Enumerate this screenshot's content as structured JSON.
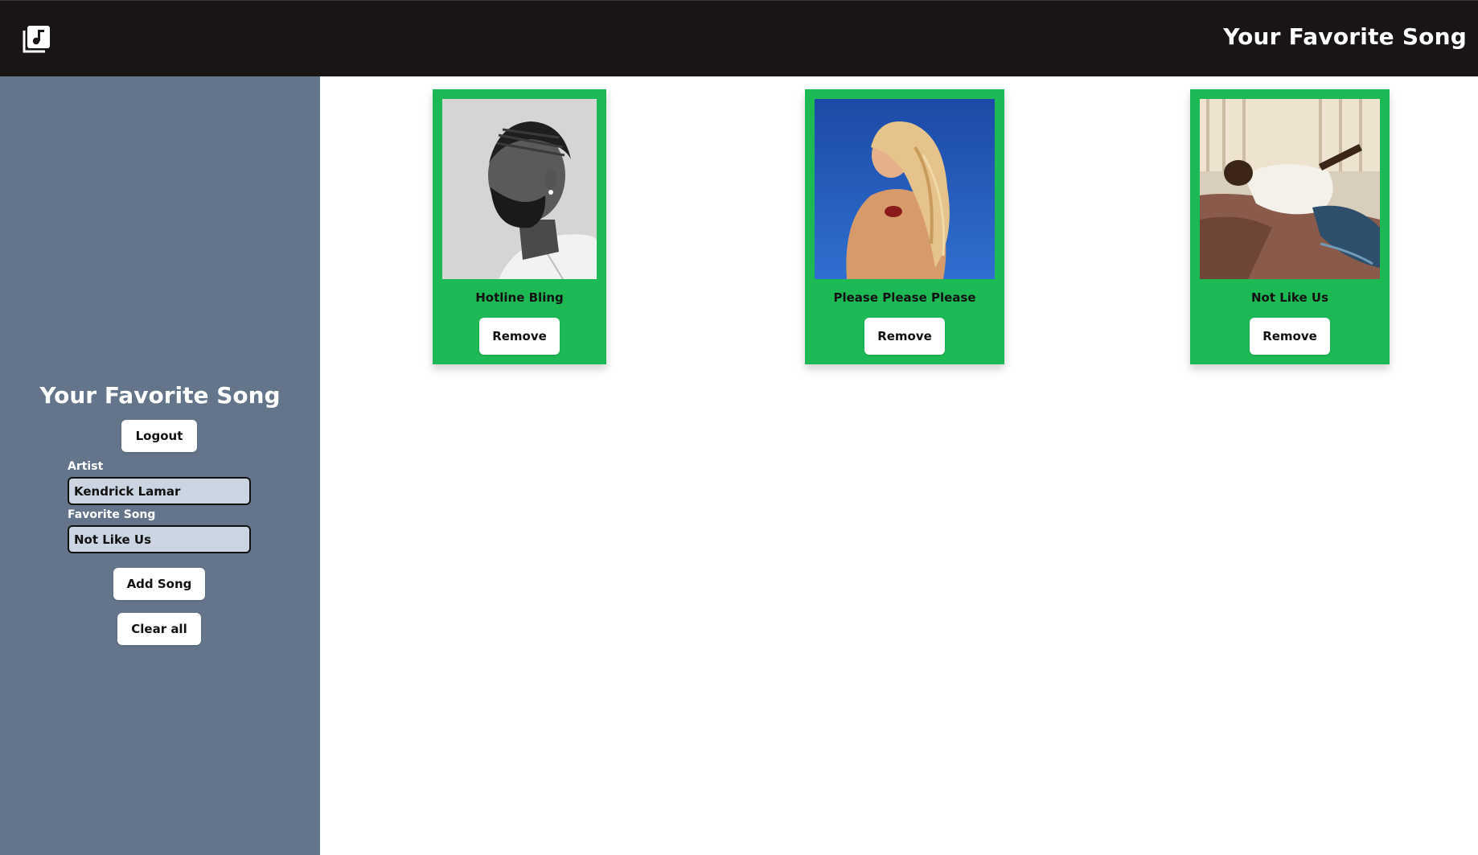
{
  "header": {
    "title": "Your Favorite Song",
    "logo_icon": "music-library-icon"
  },
  "sidebar": {
    "title": "Your Favorite Song",
    "logout_label": "Logout",
    "artist_label": "Artist",
    "artist_value": "Kendrick Lamar",
    "song_label": "Favorite Song",
    "song_value": "Not Like Us",
    "add_label": "Add Song",
    "clear_label": "Clear all"
  },
  "cards": [
    {
      "title": "Hotline Bling",
      "remove_label": "Remove",
      "image_icon": "artist-photo-grayscale"
    },
    {
      "title": "Please Please Please",
      "remove_label": "Remove",
      "image_icon": "artist-photo-blue"
    },
    {
      "title": "Not Like Us",
      "remove_label": "Remove",
      "image_icon": "artist-photo-bed"
    }
  ],
  "colors": {
    "topbar": "#181514",
    "sidebar": "#64748b",
    "card": "#1db954",
    "input_bg": "#cbd5e1"
  }
}
